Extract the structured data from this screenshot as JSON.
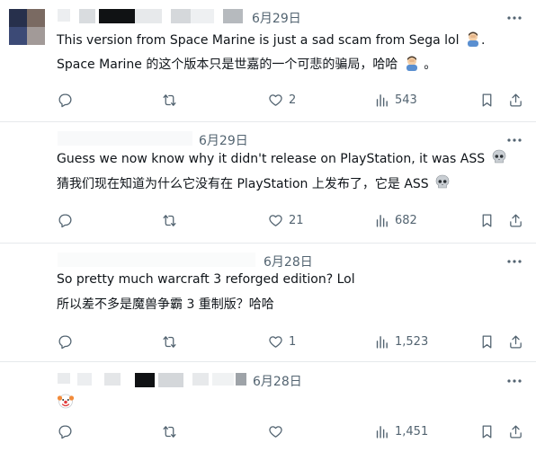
{
  "posts": [
    {
      "date": "6月29日",
      "text_en": "This version from Space Marine is just a sad scam from Sega lol",
      "text_zh": "Space Marine 的这个版本只是世嘉的一个可悲的骗局，哈哈",
      "text_zh_tail": "。",
      "en_emoji": "man-facepalming-emoji",
      "zh_emoji": "man-facepalming-emoji",
      "en_tail": ".",
      "reply_count": "",
      "retweet_count": "",
      "like_count": "2",
      "view_count": "543"
    },
    {
      "date": "6月29日",
      "text_en": "Guess we now know why it didn't release on PlayStation, it was ASS",
      "text_zh": "猜我们现在知道为什么它没有在 PlayStation 上发布了，它是 ASS",
      "en_emoji": "skull-emoji",
      "zh_emoji": "skull-emoji",
      "reply_count": "",
      "retweet_count": "",
      "like_count": "21",
      "view_count": "682"
    },
    {
      "date": "6月28日",
      "text_en": "So pretty much warcraft 3 reforged edition? Lol",
      "text_zh": "所以差不多是魔兽争霸 3 重制版？哈哈",
      "reply_count": "",
      "retweet_count": "",
      "like_count": "1",
      "view_count": "1,523"
    },
    {
      "date": "6月28日",
      "emoji_only": "clown-face-emoji",
      "reply_count": "",
      "retweet_count": "",
      "like_count": "",
      "view_count": "1,451"
    }
  ],
  "colors": {
    "text": "#0f1419",
    "muted": "#536471",
    "divider": "#e6e9ec"
  }
}
